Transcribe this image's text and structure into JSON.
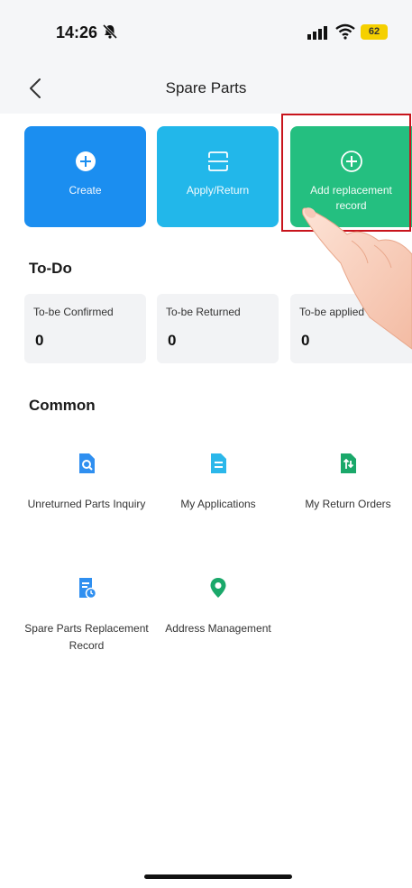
{
  "status_bar": {
    "time": "14:26",
    "battery": "62"
  },
  "nav": {
    "title": "Spare Parts"
  },
  "actions": [
    {
      "label": "Create"
    },
    {
      "label": "Apply/Return"
    },
    {
      "label": "Add replacement record"
    }
  ],
  "todo": {
    "title": "To-Do",
    "items": [
      {
        "label": "To-be Confirmed",
        "count": "0"
      },
      {
        "label": "To-be Returned",
        "count": "0"
      },
      {
        "label": "To-be applied",
        "count": "0"
      }
    ]
  },
  "common": {
    "title": "Common",
    "items": [
      {
        "label": "Unreturned Parts Inquiry",
        "icon": "doc-search-icon"
      },
      {
        "label": "My Applications",
        "icon": "doc-icon"
      },
      {
        "label": "My Return Orders",
        "icon": "return-order-icon"
      },
      {
        "label": "Spare Parts Replacement Record",
        "icon": "doc-clock-icon"
      },
      {
        "label": "Address Management",
        "icon": "location-pin-icon"
      }
    ]
  },
  "colors": {
    "create": "#1b8ef0",
    "apply": "#22b7ea",
    "add": "#24bf80",
    "highlight": "#c8141c",
    "icon_blue": "#2f8ff0",
    "icon_green": "#1aa86a"
  }
}
